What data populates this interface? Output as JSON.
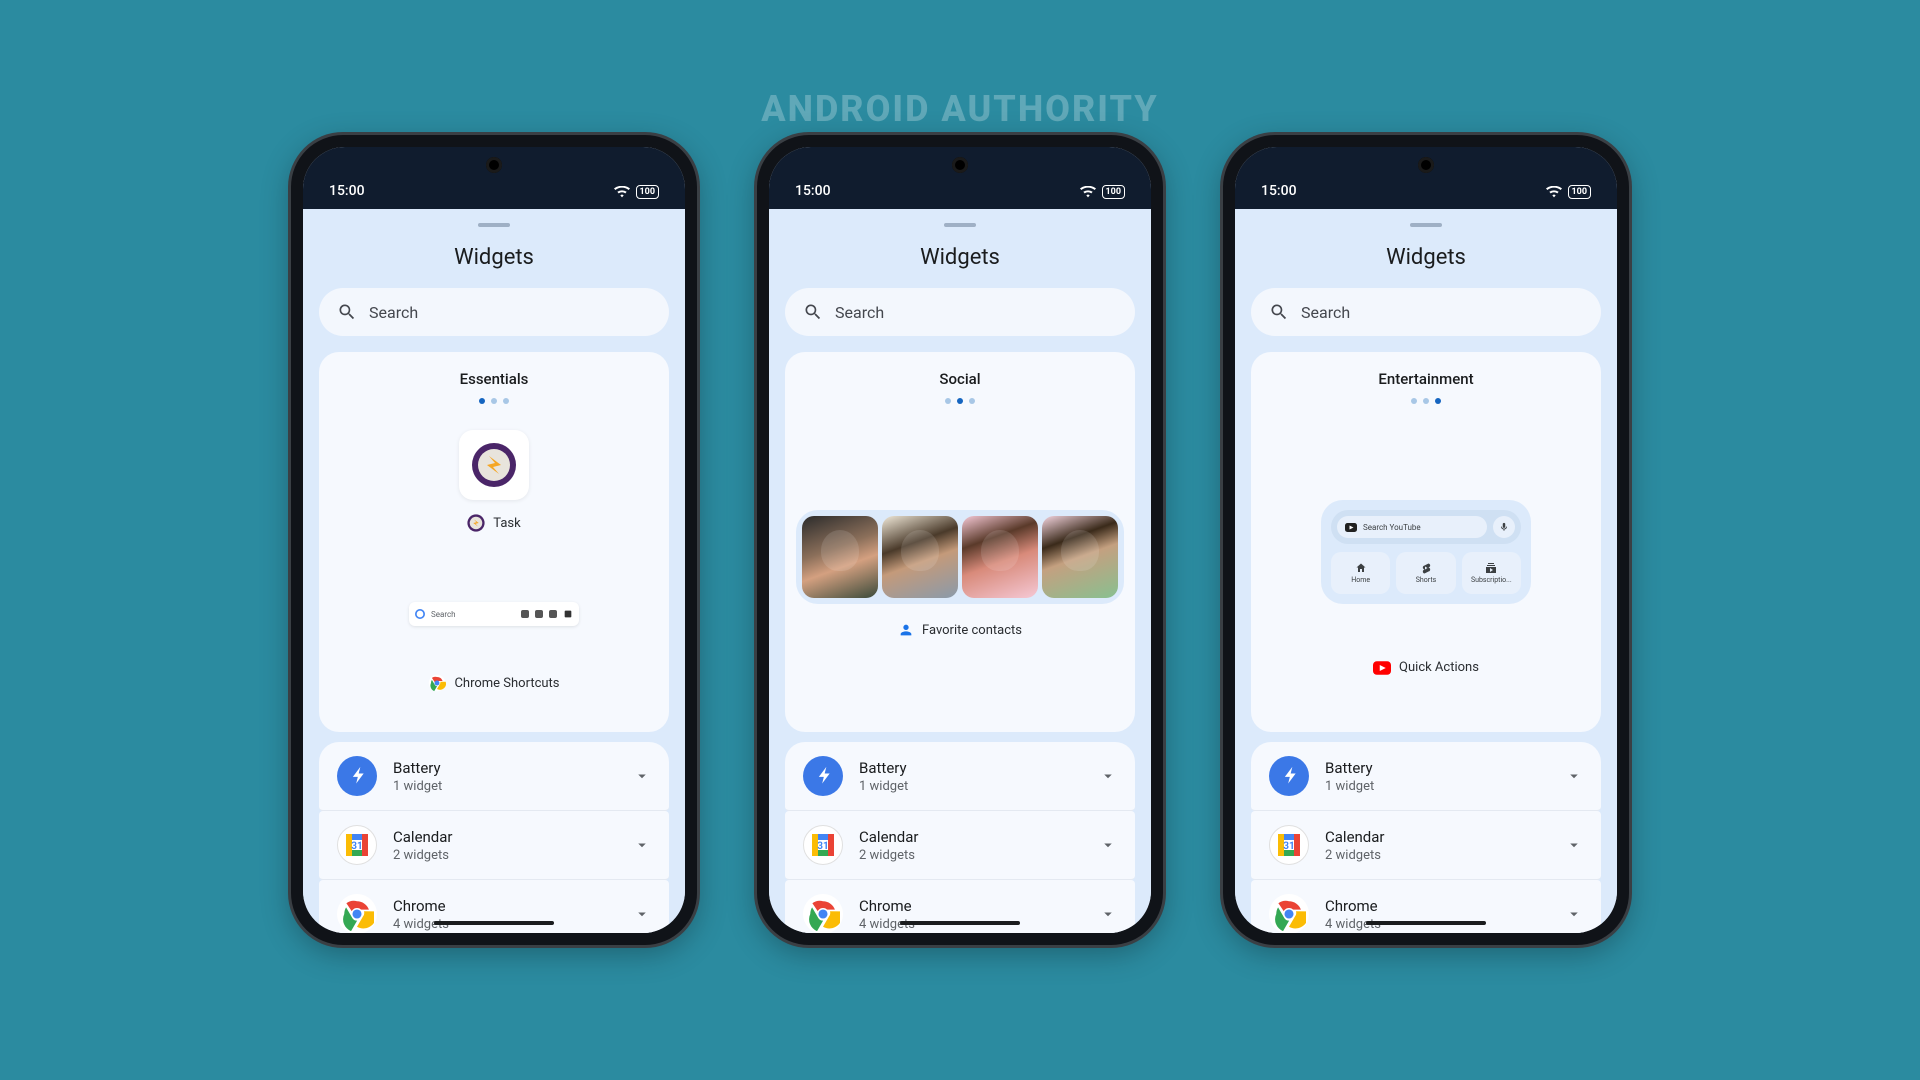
{
  "watermark": "ANDROID AUTHORITY",
  "statusbar": {
    "time": "15:00",
    "battery": "100"
  },
  "sheet": {
    "title": "Widgets",
    "search_placeholder": "Search"
  },
  "cards": [
    {
      "title": "Essentials",
      "dot_active": 0,
      "task_label": "Task",
      "chrome_search": "Search",
      "chrome_label": "Chrome Shortcuts"
    },
    {
      "title": "Social",
      "dot_active": 1,
      "contacts_label": "Favorite contacts"
    },
    {
      "title": "Entertainment",
      "dot_active": 2,
      "yt_search": "Search YouTube",
      "yt_tiles": [
        "Home",
        "Shorts",
        "Subscriptio..."
      ],
      "yt_label": "Quick Actions"
    }
  ],
  "list": [
    {
      "icon": "battery",
      "title": "Battery",
      "sub": "1 widget"
    },
    {
      "icon": "calendar",
      "title": "Calendar",
      "sub": "2 widgets"
    },
    {
      "icon": "chrome",
      "title": "Chrome",
      "sub": "4 widgets"
    }
  ]
}
